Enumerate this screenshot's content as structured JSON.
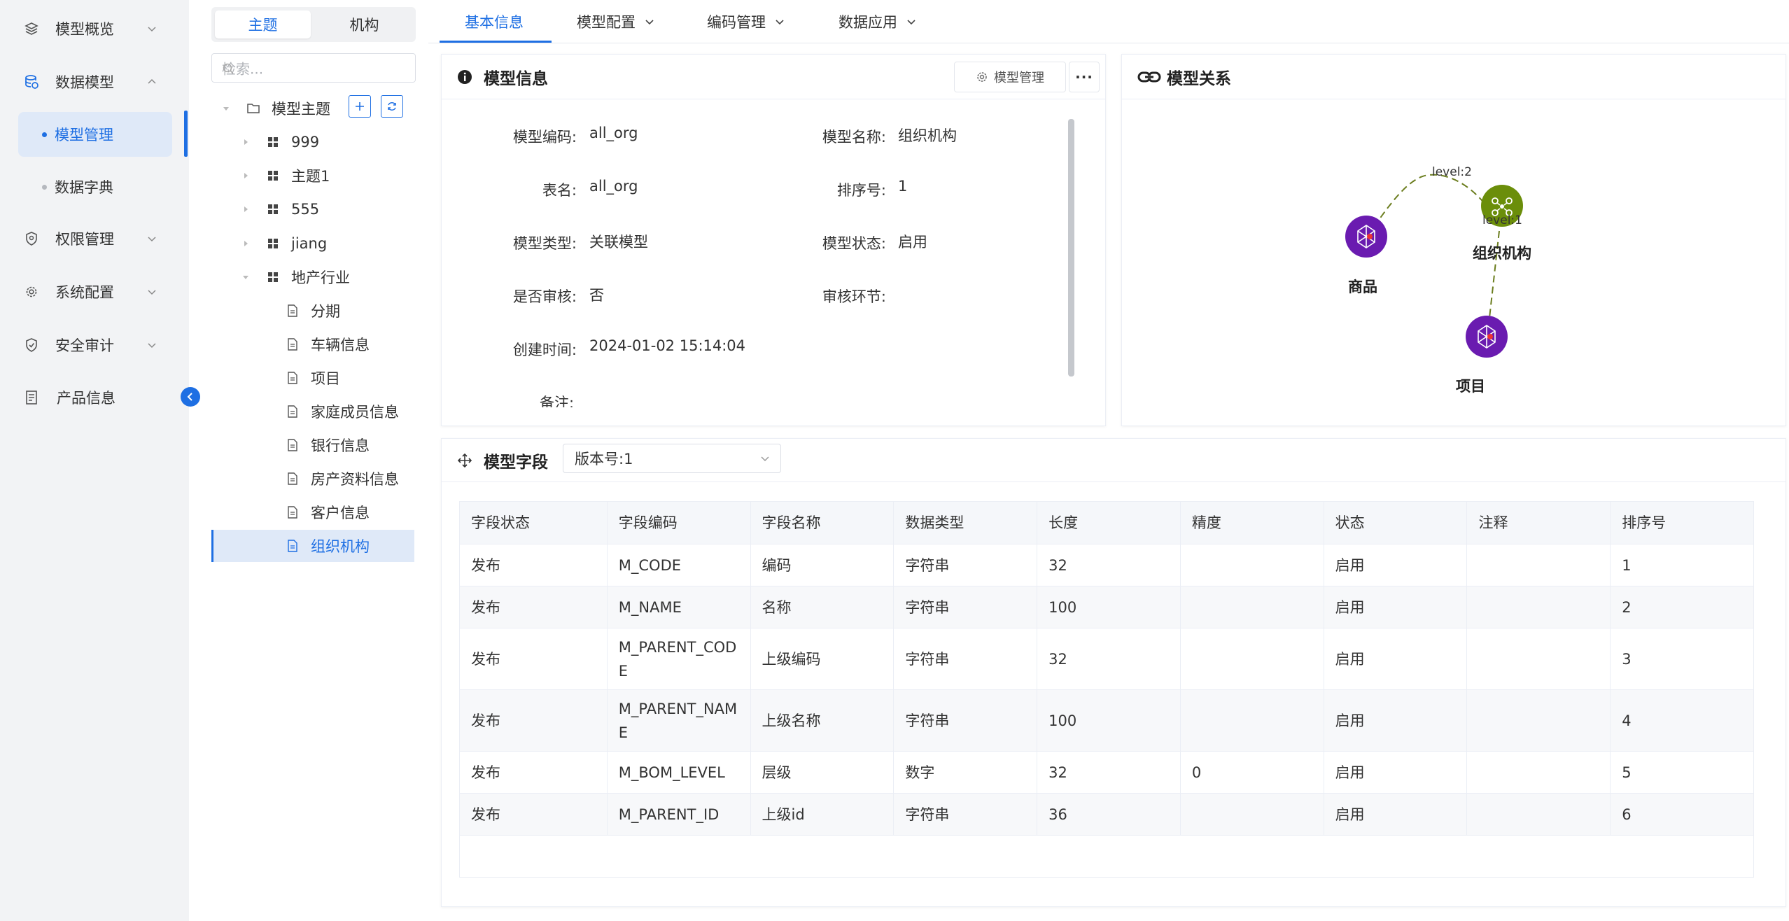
{
  "nav": {
    "items": [
      {
        "label": "模型概览",
        "icon": "layers-icon"
      },
      {
        "label": "数据模型",
        "icon": "database-icon"
      },
      {
        "label": "模型管理"
      },
      {
        "label": "数据字典"
      },
      {
        "label": "权限管理",
        "icon": "shield-icon"
      },
      {
        "label": "系统配置",
        "icon": "gear-icon"
      },
      {
        "label": "安全审计",
        "icon": "shield-check-icon"
      },
      {
        "label": "产品信息",
        "icon": "document-icon"
      }
    ],
    "accent": "#1e6fe3"
  },
  "tree": {
    "tabs": [
      "主题",
      "机构"
    ],
    "search_placeholder": "检索...",
    "root": "模型主题",
    "nodes": [
      {
        "label": "999"
      },
      {
        "label": "主题1"
      },
      {
        "label": "555"
      },
      {
        "label": "jiang"
      },
      {
        "label": "地产行业"
      },
      {
        "label": "分期"
      },
      {
        "label": "车辆信息"
      },
      {
        "label": "项目"
      },
      {
        "label": "家庭成员信息"
      },
      {
        "label": "银行信息"
      },
      {
        "label": "房产资料信息"
      },
      {
        "label": "客户信息"
      },
      {
        "label": "组织机构"
      }
    ]
  },
  "tabs": [
    "基本信息",
    "模型配置",
    "编码管理",
    "数据应用"
  ],
  "model_info": {
    "title": "模型信息",
    "manage_button": "模型管理",
    "more_button": "···",
    "fields": {
      "code_label": "模型编码:",
      "code_value": "all_org",
      "name_label": "模型名称:",
      "name_value": "组织机构",
      "table_label": "表名:",
      "table_value": "all_org",
      "sort_label": "排序号:",
      "sort_value": "1",
      "type_label": "模型类型:",
      "type_value": "关联模型",
      "status_label": "模型状态:",
      "status_value": "启用",
      "audit_label": "是否审核:",
      "audit_value": "否",
      "audit_step_label": "审核环节:",
      "created_label": "创建时间:",
      "created_value": "2024-01-02 15:14:04",
      "remark_label": "备注:"
    }
  },
  "relation": {
    "title": "模型关系",
    "nodes": [
      "商品",
      "组织机构",
      "项目"
    ],
    "edges": [
      "level:2",
      "level:1"
    ],
    "colors": {
      "purple": "#6a1bb0",
      "olive": "#6b8e0a",
      "edge": "#7a8a2a"
    }
  },
  "fields_card": {
    "title": "模型字段",
    "version": "版本号:1",
    "columns": [
      "字段状态",
      "字段编码",
      "字段名称",
      "数据类型",
      "长度",
      "精度",
      "状态",
      "注释",
      "排序号"
    ],
    "rows": [
      [
        "发布",
        "M_CODE",
        "编码",
        "字符串",
        "32",
        "",
        "启用",
        "",
        "1"
      ],
      [
        "发布",
        "M_NAME",
        "名称",
        "字符串",
        "100",
        "",
        "启用",
        "",
        "2"
      ],
      [
        "发布",
        "M_PARENT_COD\nE",
        "上级编码",
        "字符串",
        "32",
        "",
        "启用",
        "",
        "3"
      ],
      [
        "发布",
        "M_PARENT_NAM\nE",
        "上级名称",
        "字符串",
        "100",
        "",
        "启用",
        "",
        "4"
      ],
      [
        "发布",
        "M_BOM_LEVEL",
        "层级",
        "数字",
        "32",
        "0",
        "启用",
        "",
        "5"
      ],
      [
        "发布",
        "M_PARENT_ID",
        "上级id",
        "字符串",
        "36",
        "",
        "启用",
        "",
        "6"
      ]
    ]
  }
}
